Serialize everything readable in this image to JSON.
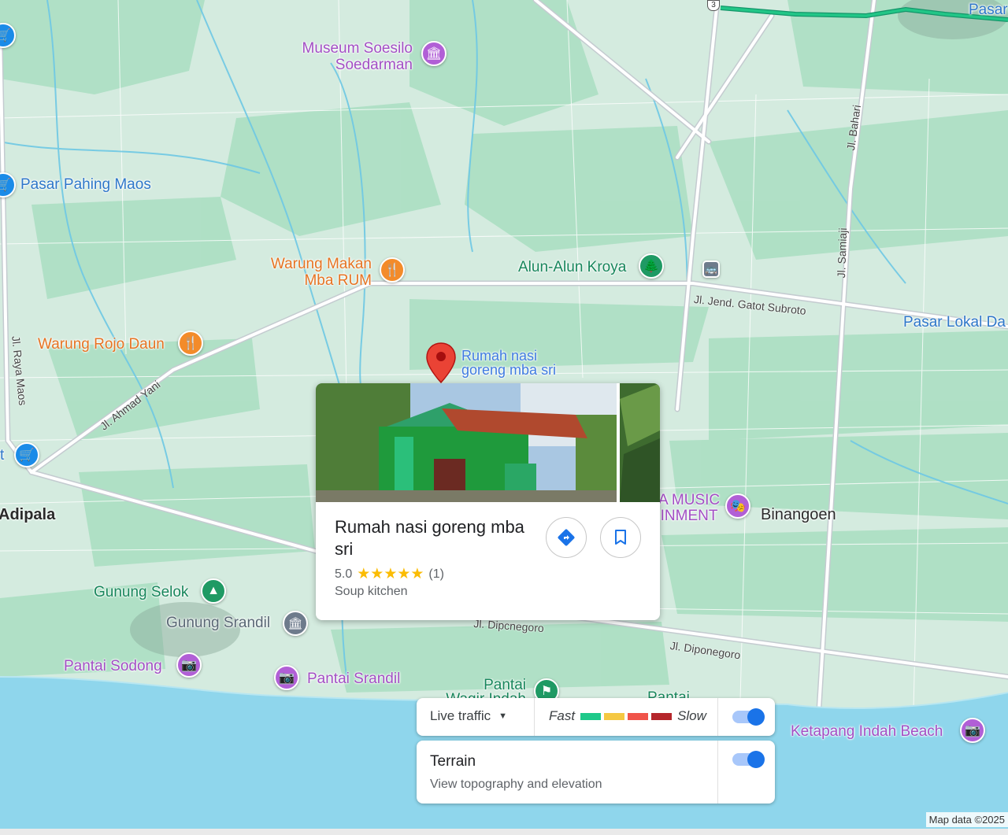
{
  "places": {
    "museum": "Museum Soesilo\nSoedarman",
    "museum_l1": "Museum Soesilo",
    "museum_l2": "Soedarman",
    "pasar_pahing": "Pasar Pahing Maos",
    "warung_makan_l1": "Warung Makan",
    "warung_makan_l2": "Mba RUM",
    "alun_alun": "Alun-Alun Kroya",
    "warung_rojo": "Warung Rojo Daun",
    "pasar_lokal": "Pasar Lokal Da",
    "pasar_top": "Pasar",
    "selected_l1": "Rumah nasi",
    "selected_l2": "goreng mba sri",
    "music_l1": "A MUSIC",
    "music_l2": "INMENT",
    "binangoen": "Binangoen",
    "adipala": "Adipala",
    "gunung_selok": "Gunung Selok",
    "gunung_srandil": "Gunung Srandil",
    "pantai_sodong": "Pantai Sodong",
    "pantai_srandil": "Pantai Srandil",
    "pantai_wagir_l1": "Pantai",
    "pantai_wagir_l2": "Wagir Indah",
    "pantai_right": "Pantai",
    "ketapang": "Ketapang Indah Beach",
    "left_edge_t": "t"
  },
  "roads": {
    "gatot": "Jl. Jend. Gatot Subroto",
    "bahari": "Jl. Bahari",
    "samiaji": "Jl. Samiaji",
    "raya_maos": "Jl. Raya Maos",
    "ahmad_yani": "Jl. Ahmad Yani",
    "dipo1": "Jl. Dipcnegoro",
    "dipo2": "Jl. Diponegoro",
    "route_num": "3"
  },
  "card": {
    "title": "Rumah nasi goreng mba sri",
    "rating": "5.0",
    "stars": "★★★★★",
    "reviews": "(1)",
    "category": "Soup kitchen",
    "directions_icon": "directions-icon",
    "save_icon": "bookmark-icon"
  },
  "layers": {
    "traffic_label": "Live traffic",
    "fast": "Fast",
    "slow": "Slow",
    "traffic_colors": [
      "#1ec98a",
      "#f5c842",
      "#f0544a",
      "#b5262b"
    ],
    "traffic_on": true,
    "terrain_title": "Terrain",
    "terrain_sub": "View topography and elevation",
    "terrain_on": true
  },
  "attribution": "Map data ©2025",
  "colors": {
    "land": "#cfe9de",
    "green_patch": "#a9dfc0",
    "sea": "#8fd6ec",
    "road": "#ffffff",
    "river": "#6bc7e6",
    "route": "#19b27a",
    "pin_red": "#ea4335"
  }
}
